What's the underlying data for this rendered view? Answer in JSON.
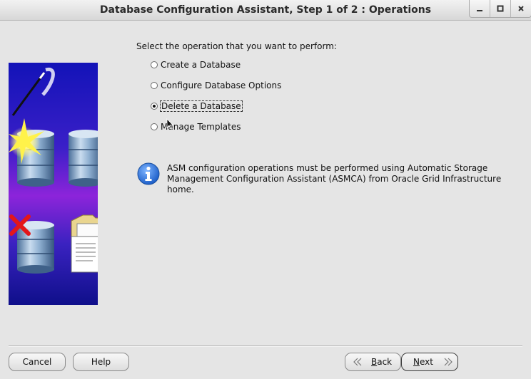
{
  "window": {
    "title": "Database Configuration Assistant, Step 1 of 2 : Operations",
    "controls": [
      "minimize-icon",
      "maximize-icon",
      "close-icon"
    ]
  },
  "main": {
    "prompt": "Select the operation that you want to perform:",
    "operations": [
      {
        "label": "Create a Database",
        "selected": false
      },
      {
        "label": "Configure Database Options",
        "selected": false
      },
      {
        "label": "Delete a Database",
        "selected": true
      },
      {
        "label": "Manage Templates",
        "selected": false
      }
    ],
    "info_line1": "ASM configuration operations must be performed using Automatic Storage",
    "info_line2": "Management Configuration Assistant (ASMCA) from Oracle Grid Infrastructure home."
  },
  "footer": {
    "cancel": "Cancel",
    "help": "Help",
    "back_mnemonic": "B",
    "back_rest": "ack",
    "next_mnemonic": "N",
    "next_rest": "ext"
  },
  "colors": {
    "background": "#e5e5e5",
    "panel_blue": "#1515b5",
    "panel_purple": "#8a22d8",
    "info_blue": "#2a6fd6"
  }
}
